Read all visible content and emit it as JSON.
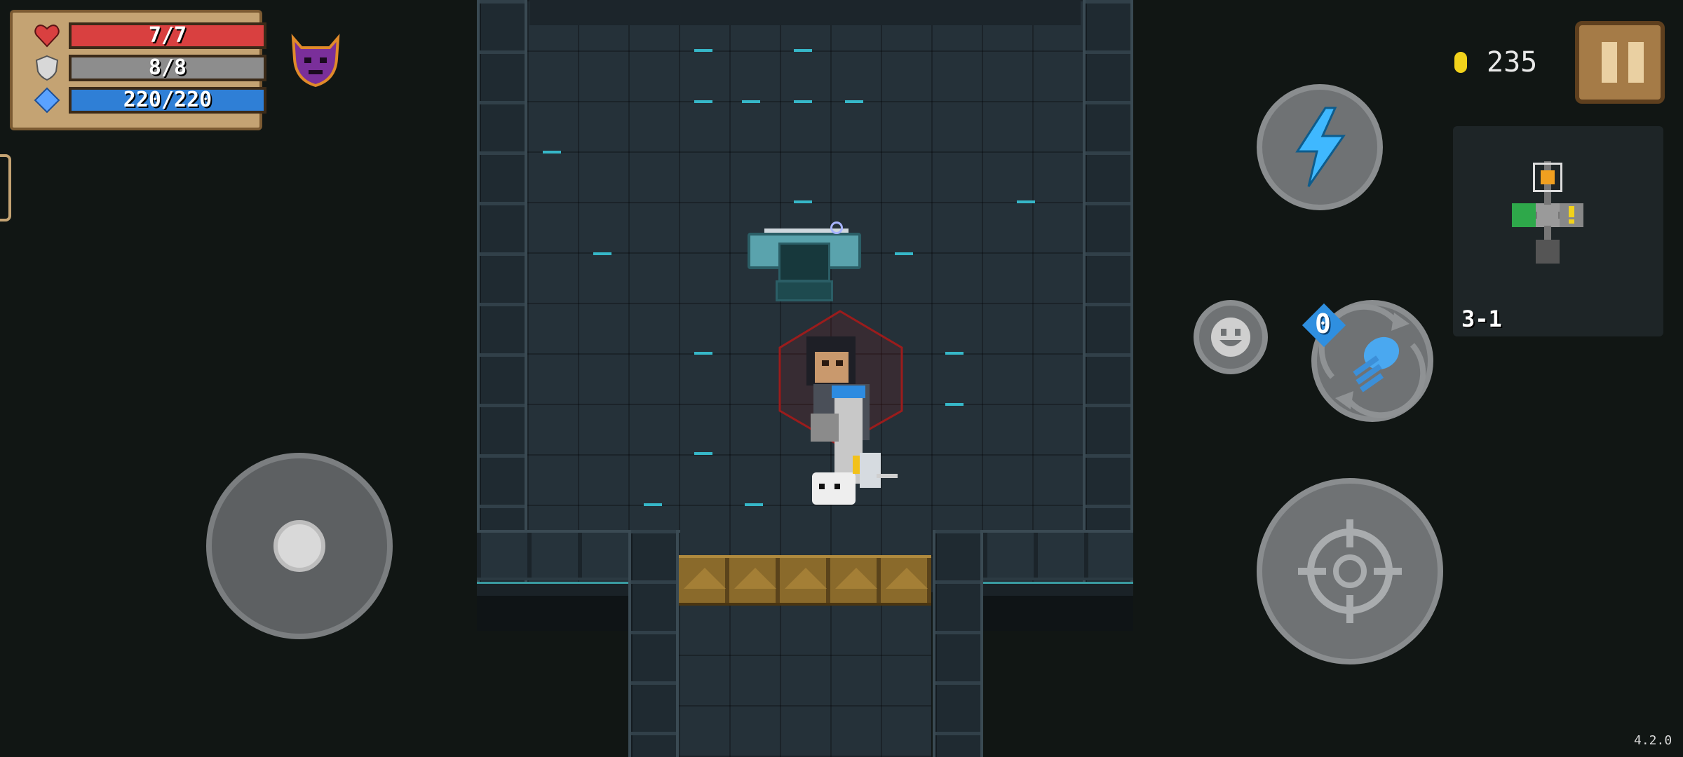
{
  "hud": {
    "health": {
      "label": "7/7",
      "current": 7,
      "max": 7,
      "color": "#d94040"
    },
    "armor": {
      "label": "8/8",
      "current": 8,
      "max": 8,
      "color": "#8d8d8d"
    },
    "energy": {
      "label": "220/220",
      "current": 220,
      "max": 220,
      "color": "#2f7fd6"
    },
    "buff_icon": "purple-demon-mask-icon",
    "coins": "235",
    "level": "3-1",
    "skill_counter": "0",
    "version": "4.2.0"
  },
  "controls": {
    "skill_icon": "lightning-bolt-icon",
    "emote_icon": "smiley-face-icon",
    "weapon_swap_icon": "jellyfish-weapon-icon",
    "attack_icon": "crosshair-icon",
    "pause_icon": "pause-icon"
  },
  "colors": {
    "accent_cyan": "#36b7c8",
    "coin": "#f2d21b",
    "button_gray": "#6f7274",
    "panel": "#c4a373"
  }
}
